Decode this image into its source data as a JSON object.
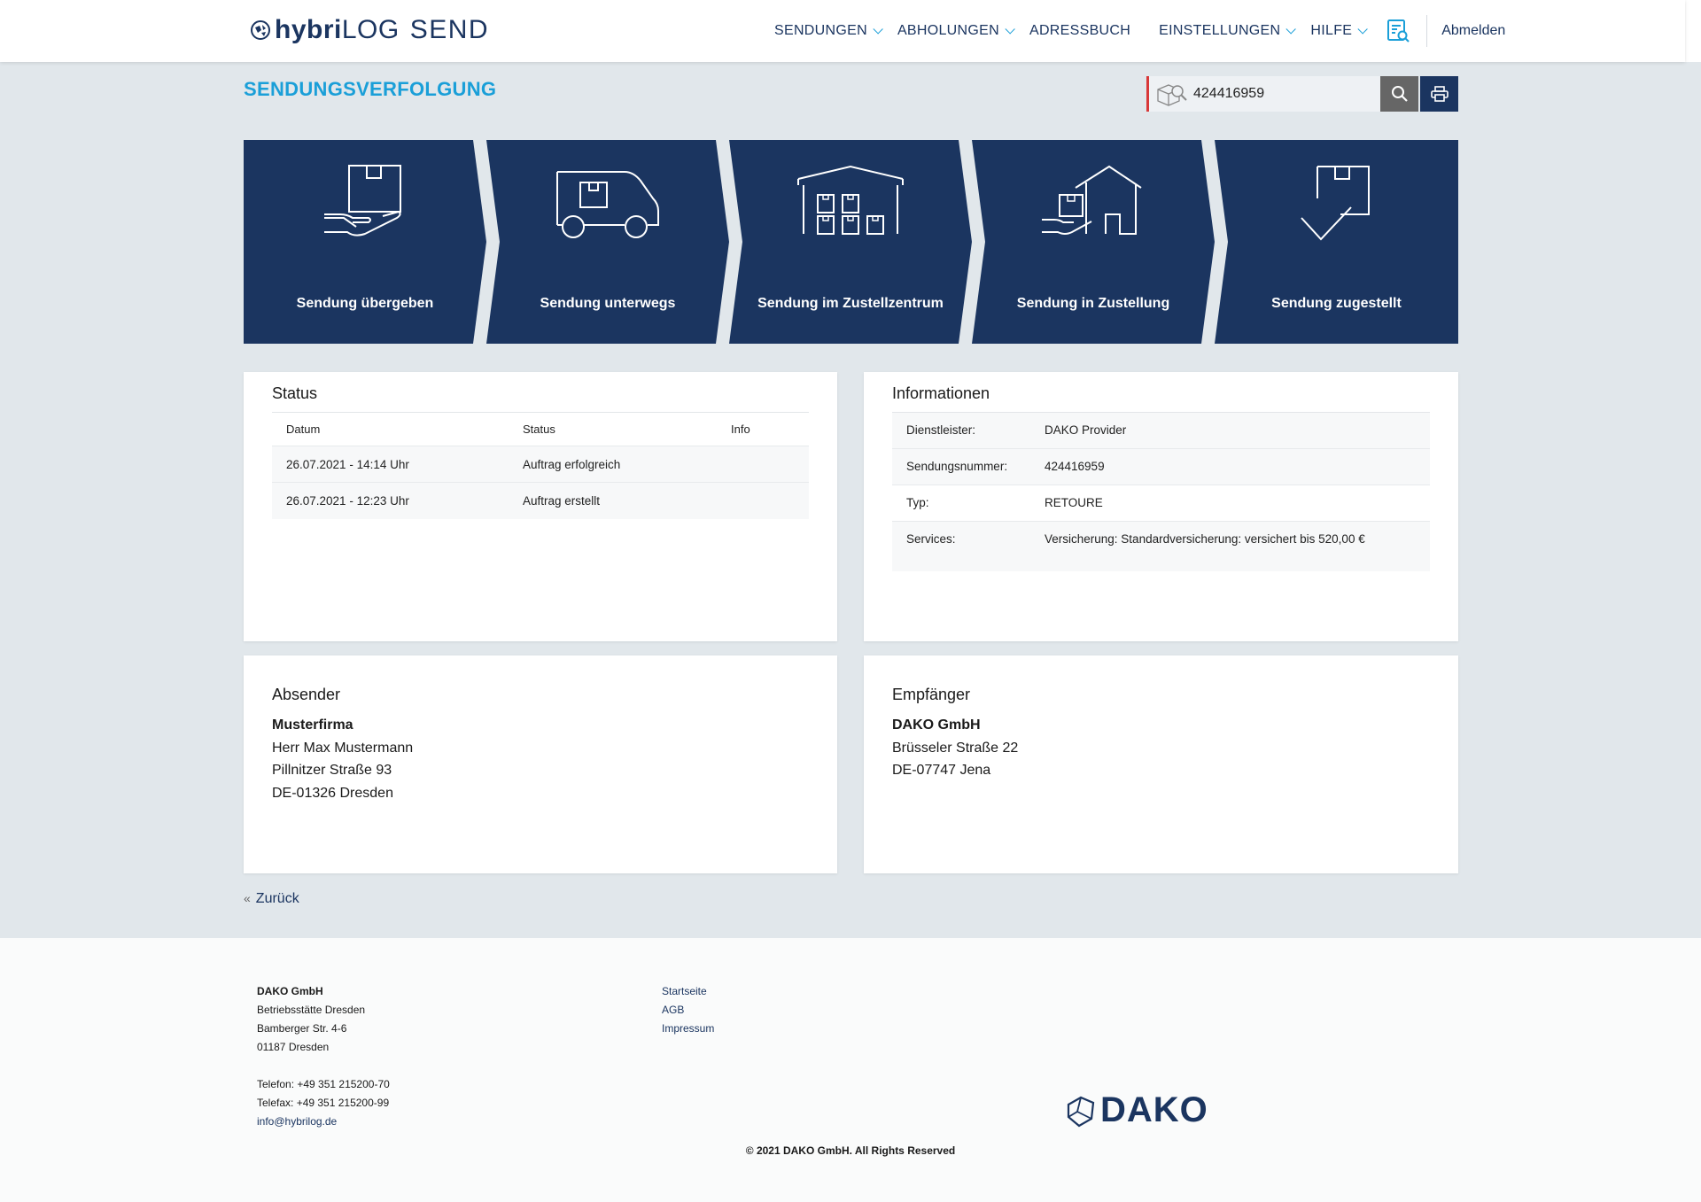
{
  "header": {
    "logo_bold": "hybri",
    "logo_light": "LOG",
    "logo_send": "SEND",
    "nav": [
      {
        "label": "SENDUNGEN",
        "dropdown": true
      },
      {
        "label": "ABHOLUNGEN",
        "dropdown": true
      },
      {
        "label": "ADRESSBUCH",
        "dropdown": false
      },
      {
        "label": "EINSTELLUNGEN",
        "dropdown": true
      },
      {
        "label": "HILFE",
        "dropdown": true
      }
    ],
    "logout": "Abmelden",
    "accent": "#1a9fd8",
    "brand": "#1b3560"
  },
  "page": {
    "title": "SENDUNGSVERFOLGUNG",
    "search_value": "424416959"
  },
  "steps": [
    {
      "label": "Sendung übergeben",
      "icon": "parcel-hand-icon"
    },
    {
      "label": "Sendung unterwegs",
      "icon": "van-icon"
    },
    {
      "label": "Sendung im Zustellzentrum",
      "icon": "warehouse-icon"
    },
    {
      "label": "Sendung in Zustellung",
      "icon": "house-delivery-icon"
    },
    {
      "label": "Sendung zugestellt",
      "icon": "delivered-arrow-icon"
    }
  ],
  "status": {
    "title": "Status",
    "headers": [
      "Datum",
      "Status",
      "Info"
    ],
    "rows": [
      {
        "date": "26.07.2021 - 14:14 Uhr",
        "status": "Auftrag erfolgreich",
        "info": ""
      },
      {
        "date": "26.07.2021 - 12:23 Uhr",
        "status": "Auftrag erstellt",
        "info": ""
      }
    ]
  },
  "info": {
    "title": "Informationen",
    "rows": [
      {
        "key": "Dienstleister:",
        "value": "DAKO Provider"
      },
      {
        "key": "Sendungsnummer:",
        "value": "424416959"
      },
      {
        "key": "Typ:",
        "value": "RETOURE"
      },
      {
        "key": "Services:",
        "value": "Versicherung: Standardversicherung: versichert bis 520,00 €"
      }
    ]
  },
  "sender": {
    "title": "Absender",
    "company": "Musterfirma",
    "lines": [
      "Herr Max Mustermann",
      "Pillnitzer Straße 93",
      "DE-01326 Dresden"
    ]
  },
  "recipient": {
    "title": "Empfänger",
    "company": "DAKO GmbH",
    "lines": [
      "Brüsseler Straße 22",
      "DE-07747 Jena"
    ]
  },
  "back_label": "Zurück",
  "footer": {
    "company": "DAKO GmbH",
    "address": [
      "Betriebsstätte Dresden",
      "Bamberger Str. 4-6",
      "01187 Dresden"
    ],
    "phone": "Telefon: +49 351 215200-70",
    "fax": "Telefax: +49 351 215200-99",
    "email": "info@hybrilog.de",
    "links": [
      "Startseite",
      "AGB",
      "Impressum"
    ],
    "brand": "DAKO",
    "copyright": "© 2021 DAKO GmbH. All Rights Reserved"
  }
}
